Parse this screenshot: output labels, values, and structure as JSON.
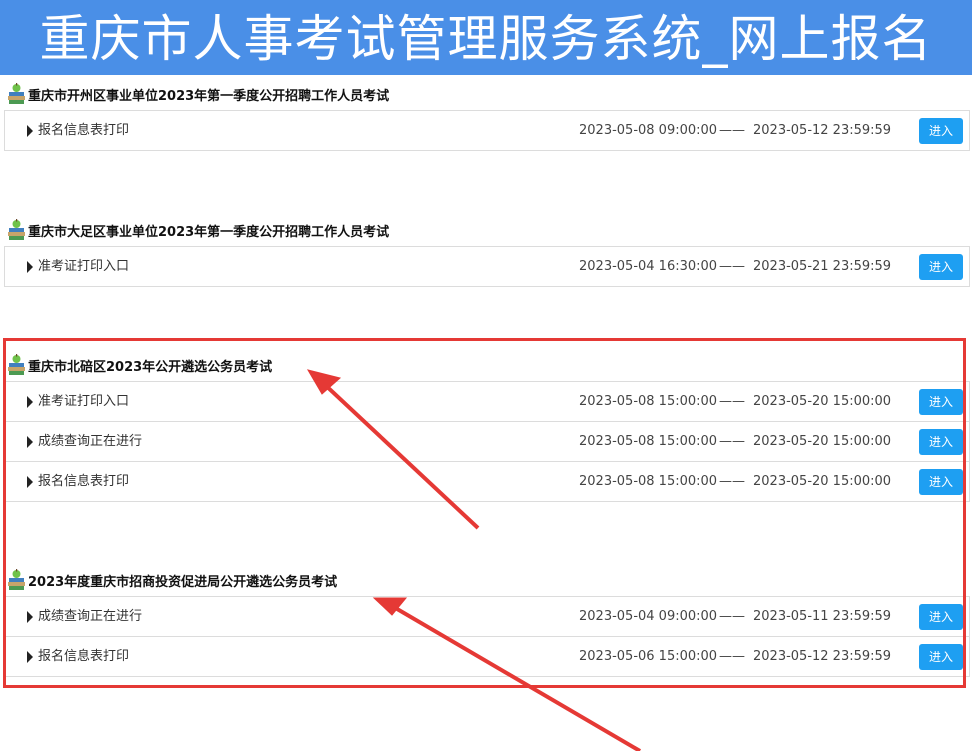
{
  "header": {
    "title": "重庆市人事考试管理服务系统_网上报名"
  },
  "exams": [
    {
      "title": "重庆市开州区事业单位2023年第一季度公开招聘工作人员考试",
      "items": [
        {
          "label": "报名信息表打印",
          "start": "2023-05-08 09:00:00",
          "end": "2023-05-12 23:59:59",
          "button": "进入"
        }
      ]
    },
    {
      "title": "重庆市大足区事业单位2023年第一季度公开招聘工作人员考试",
      "items": [
        {
          "label": "准考证打印入口",
          "start": "2023-05-04 16:30:00",
          "end": "2023-05-21 23:59:59",
          "button": "进入"
        }
      ]
    },
    {
      "title": "重庆市北碚区2023年公开遴选公务员考试",
      "items": [
        {
          "label": "准考证打印入口",
          "start": "2023-05-08 15:00:00",
          "end": "2023-05-20 15:00:00",
          "button": "进入"
        },
        {
          "label": "成绩查询正在进行",
          "start": "2023-05-08 15:00:00",
          "end": "2023-05-20 15:00:00",
          "button": "进入"
        },
        {
          "label": "报名信息表打印",
          "start": "2023-05-08 15:00:00",
          "end": "2023-05-20 15:00:00",
          "button": "进入"
        }
      ]
    },
    {
      "title": "2023年度重庆市招商投资促进局公开遴选公务员考试",
      "items": [
        {
          "label": "成绩查询正在进行",
          "start": "2023-05-04 09:00:00",
          "end": "2023-05-11 23:59:59",
          "button": "进入"
        },
        {
          "label": "报名信息表打印",
          "start": "2023-05-06 15:00:00",
          "end": "2023-05-12 23:59:59",
          "button": "进入"
        }
      ]
    }
  ],
  "separator": "——",
  "colors": {
    "banner": "#4a8fe7",
    "button": "#1e9ff2",
    "annotation": "#e53935"
  },
  "icons": {
    "exam": "book-stack-apple-icon",
    "item": "triangle-right-icon"
  }
}
